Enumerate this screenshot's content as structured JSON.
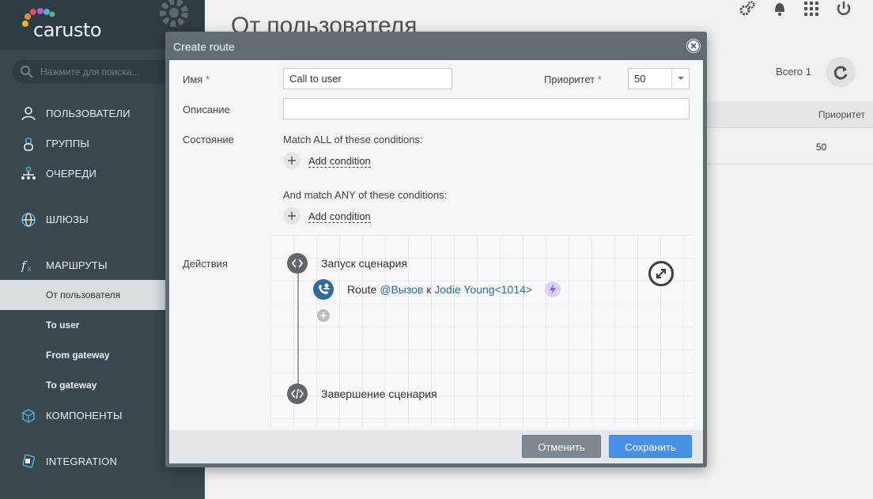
{
  "brand": {
    "name": "carusto"
  },
  "search": {
    "placeholder": "Нажмите для поиска..."
  },
  "sidebar": {
    "items": [
      {
        "label": "ПОЛЬЗОВАТЕЛИ",
        "icon": "user-icon"
      },
      {
        "label": "ГРУППЫ",
        "icon": "group-icon"
      },
      {
        "label": "ОЧЕРЕДИ",
        "icon": "queue-icon"
      },
      {
        "label": "ШЛЮЗЫ",
        "icon": "globe-icon"
      },
      {
        "label": "МАРШРУТЫ",
        "icon": "fx-icon"
      },
      {
        "label": "КОМПОНЕНТЫ",
        "icon": "cube-icon"
      },
      {
        "label": "INTEGRATION",
        "icon": "integration-icon"
      }
    ],
    "route_subitems": [
      {
        "label": "От пользователя",
        "active": true
      },
      {
        "label": "To user",
        "active": false
      },
      {
        "label": "From gateway",
        "active": false
      },
      {
        "label": "To gateway",
        "active": false
      }
    ]
  },
  "main": {
    "title": "От пользователя",
    "total": "Всего 1",
    "table": {
      "column": "Приоритет",
      "rows": [
        {
          "priority": "50"
        }
      ]
    }
  },
  "dialog": {
    "title": "Create route",
    "name_label": "Имя",
    "name_value": "Call to user",
    "priority_label": "Приоритет",
    "priority_value": "50",
    "description_label": "Описание",
    "description_value": "",
    "state_label": "Состояние",
    "match_all_text": "Match ALL of these conditions:",
    "match_any_text": "And match ANY of these conditions:",
    "add_condition_label": "Add condition",
    "actions_label": "Действия",
    "flow": {
      "start": "Запуск сценария",
      "end": "Завершение сценария",
      "route_word": "Route",
      "route_var": "@Вызов",
      "route_to": "к",
      "route_target": "Jodie Young<1014>"
    },
    "cancel_label": "Отменить",
    "save_label": "Сохранить"
  },
  "colors": {
    "sidebar": "#3d4c54",
    "accent": "#4a90e2",
    "route": "#2f6a9c",
    "required": "#d9534f"
  }
}
